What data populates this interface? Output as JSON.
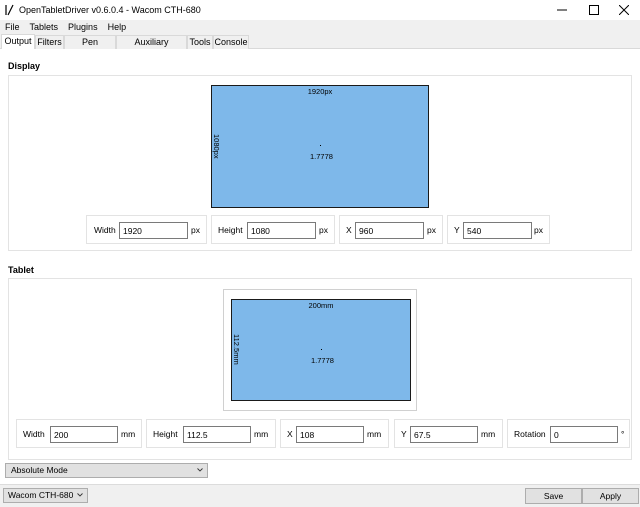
{
  "window": {
    "title": "OpenTabletDriver v0.6.0.4 - Wacom CTH-680"
  },
  "menu": [
    "File",
    "Tablets",
    "Plugins",
    "Help"
  ],
  "tabs": [
    "Output",
    "Filters",
    "Pen Settings",
    "Auxiliary Settings",
    "Tools",
    "Console"
  ],
  "display": {
    "section_title": "Display",
    "area": {
      "width_label": "1920px",
      "height_label": "1080px",
      "ratio": "1.7778"
    },
    "fields": [
      {
        "label": "Width",
        "value": "1920",
        "unit": "px"
      },
      {
        "label": "Height",
        "value": "1080",
        "unit": "px"
      },
      {
        "label": "X",
        "value": "960",
        "unit": "px"
      },
      {
        "label": "Y",
        "value": "540",
        "unit": "px"
      }
    ]
  },
  "tablet": {
    "section_title": "Tablet",
    "area": {
      "width_label": "200mm",
      "height_label": "112.5mm",
      "ratio": "1.7778"
    },
    "fields": [
      {
        "label": "Width",
        "value": "200",
        "unit": "mm"
      },
      {
        "label": "Height",
        "value": "112.5",
        "unit": "mm"
      },
      {
        "label": "X",
        "value": "108",
        "unit": "mm"
      },
      {
        "label": "Y",
        "value": "67.5",
        "unit": "mm"
      },
      {
        "label": "Rotation",
        "value": "0",
        "unit": "°"
      }
    ]
  },
  "output_mode": "Absolute Mode",
  "bottom": {
    "tablet_selector": "Wacom CTH-680",
    "save": "Save",
    "apply": "Apply"
  },
  "colors": {
    "area_fill": "#7eb8ea",
    "chrome": "#f0f0f0"
  },
  "icons": [
    "app-icon",
    "minimize-icon",
    "maximize-icon",
    "close-icon",
    "chevron-down-icon"
  ]
}
